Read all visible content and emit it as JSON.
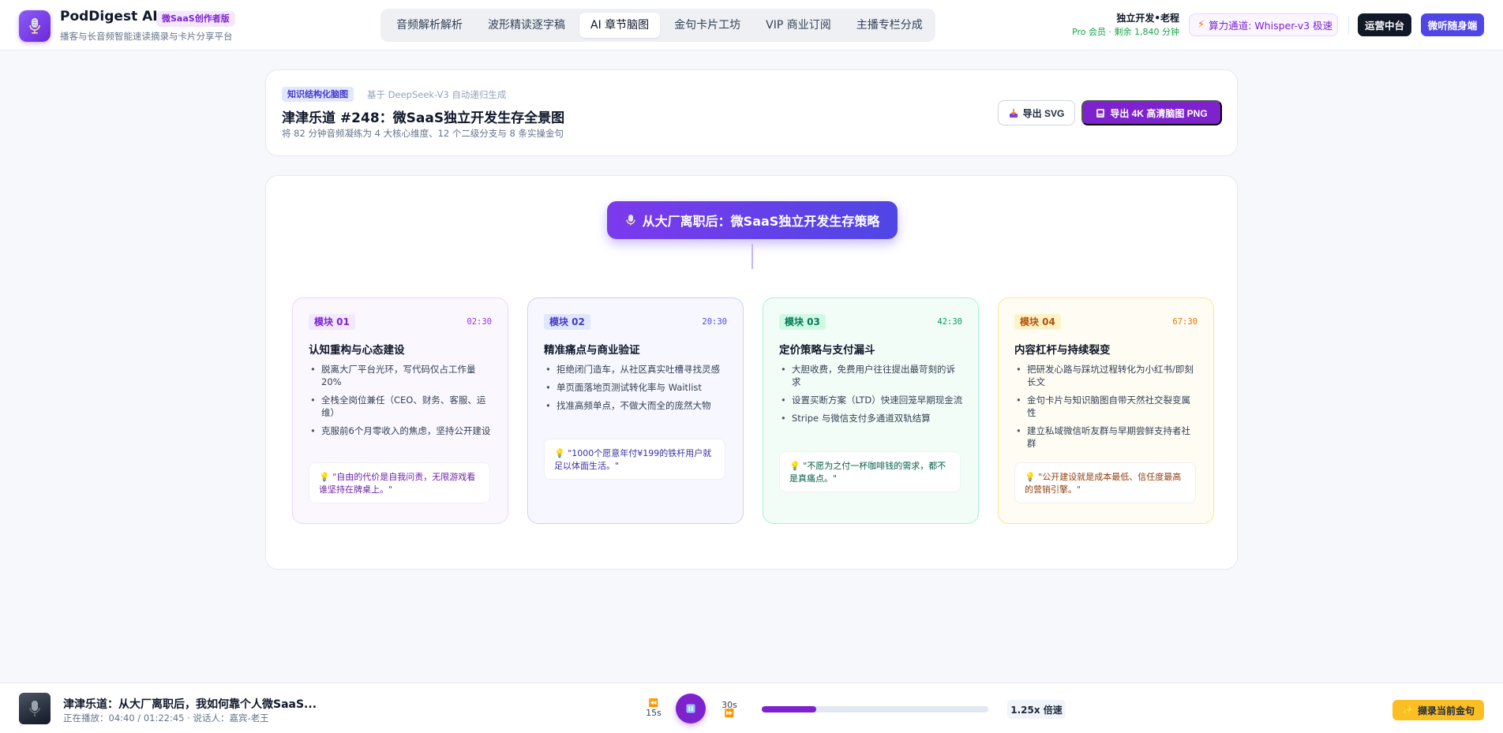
{
  "brand": {
    "name": "PodDigest AI",
    "badge": "微SaaS创作者版",
    "subtitle": "播客与长音频智能速读摘录与卡片分享平台"
  },
  "nav": {
    "tabs": [
      {
        "label": "音频解析解析",
        "active": false
      },
      {
        "label": "波形精读逐字稿",
        "active": false
      },
      {
        "label": "AI 章节脑图",
        "active": true
      },
      {
        "label": "金句卡片工坊",
        "active": false
      },
      {
        "label": "VIP 商业订阅",
        "active": false
      },
      {
        "label": "主播专栏分成",
        "active": false
      }
    ]
  },
  "user": {
    "name": "独立开发•老程",
    "plan": "Pro 会员 · 剩余 1,840 分钟"
  },
  "engine": {
    "label": "算力通道: Whisper-v3 极速"
  },
  "header_buttons": {
    "ops": "运营中台",
    "micro": "微听随身端"
  },
  "episode": {
    "badge": "知识结构化脑图",
    "note": "基于 DeepSeek-V3 自动递归生成",
    "title": "津津乐道 #248：微SaaS独立开发生存全景图",
    "desc": "将 82 分钟音频凝练为 4 大核心维度、12 个二级分支与 8 条实操金句",
    "export_svg": "导出 SVG",
    "export_png": "导出 4K 高清脑图 PNG"
  },
  "mindmap": {
    "root": "从大厂离职后：微SaaS独立开发生存策略",
    "modules": [
      {
        "tag": "模块 01",
        "time": "02:30",
        "title": "认知重构与心态建设",
        "points": [
          "脱离大厂平台光环，写代码仅占工作量20%",
          "全栈全岗位兼任（CEO、财务、客服、运维）",
          "克服前6个月零收入的焦虑，坚持公开建设"
        ],
        "quote": "\"自由的代价是自我问责，无限游戏看谁坚持在牌桌上。\"",
        "colors": {
          "bg": "#fbf7ff",
          "border": "#e9d5ff",
          "tag_bg": "#f3e8ff",
          "tag_text": "#7e22ce",
          "time": "#9333ea",
          "quote_text": "#6b21a8"
        }
      },
      {
        "tag": "模块 02",
        "time": "20:30",
        "title": "精准痛点与商业验证",
        "points": [
          "拒绝闭门造车，从社区真实吐槽寻找灵感",
          "单页面落地页测试转化率与 Waitlist",
          "找准高频单点，不做大而全的庞然大物"
        ],
        "quote": "\"1000个愿意年付¥199的铁杆用户就足以体面生活。\"",
        "colors": {
          "bg": "#f6f7ff",
          "border": "#c7d2fe",
          "tag_bg": "#e0e7ff",
          "tag_text": "#4338ca",
          "time": "#4f46e5",
          "quote_text": "#3730a3"
        }
      },
      {
        "tag": "模块 03",
        "time": "42:30",
        "title": "定价策略与支付漏斗",
        "points": [
          "大胆收费，免费用户往往提出最苛刻的诉求",
          "设置买断方案（LTD）快速回笼早期现金流",
          "Stripe 与微信支付多通道双轨结算"
        ],
        "quote": "\"不愿为之付一杯咖啡钱的需求，都不是真痛点。\"",
        "colors": {
          "bg": "#f3fdf8",
          "border": "#a7f3d0",
          "tag_bg": "#d1fae5",
          "tag_text": "#047857",
          "time": "#059669",
          "quote_text": "#065f46"
        }
      },
      {
        "tag": "模块 04",
        "time": "67:30",
        "title": "内容杠杆与持续裂变",
        "points": [
          "把研发心路与踩坑过程转化为小红书/即刻长文",
          "金句卡片与知识脑图自带天然社交裂变属性",
          "建立私域微信听友群与早期尝鲜支持者社群"
        ],
        "quote": "\"公开建设就是成本最低、信任度最高的营销引擎。\"",
        "colors": {
          "bg": "#fffcf3",
          "border": "#fde68a",
          "tag_bg": "#fef3c7",
          "tag_text": "#b45309",
          "time": "#d97706",
          "quote_text": "#92400e"
        }
      }
    ]
  },
  "player": {
    "title": "津津乐道：从大厂离职后，我如何靠个人微SaaS...",
    "subtitle": "正在播放：04:40 / 01:22:45 · 说话人：嘉宾-老王",
    "back_label": "15s",
    "fwd_label": "30s",
    "progress": 0.24,
    "speed": "1.25x 倍速",
    "quote_button": "撷录当前金句"
  }
}
